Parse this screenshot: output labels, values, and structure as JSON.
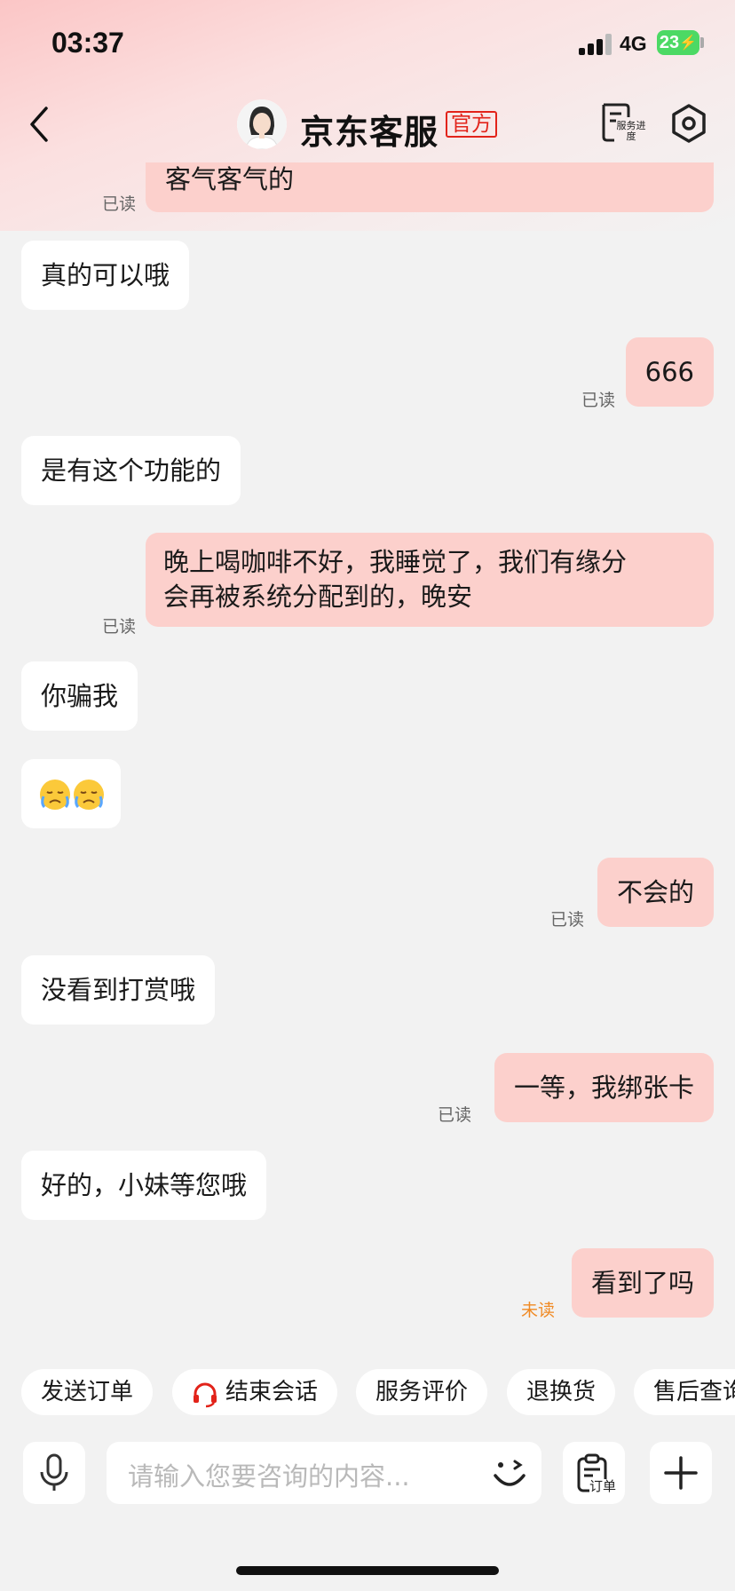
{
  "status_bar": {
    "time": "03:37",
    "network": "4G",
    "battery": "23"
  },
  "header": {
    "title": "京东客服",
    "badge": "官方",
    "service_progress_label": "服务进度"
  },
  "messages": [
    {
      "side": "out",
      "text": "客气客气的",
      "status": "已读"
    },
    {
      "side": "in",
      "text": "真的可以哦"
    },
    {
      "side": "out",
      "text": "666",
      "status": "已读"
    },
    {
      "side": "in",
      "text": "是有这个功能的"
    },
    {
      "side": "out",
      "lines": [
        "晚上喝咖啡不好，我睡觉了，我们有缘分",
        "会再被系统分配到的，晚安"
      ],
      "status": "已读"
    },
    {
      "side": "in",
      "text": "你骗我"
    },
    {
      "side": "in",
      "emoji": "😞😞"
    },
    {
      "side": "out",
      "text": "不会的",
      "status": "已读"
    },
    {
      "side": "in",
      "text": "没看到打赏哦"
    },
    {
      "side": "out",
      "text": "一等，我绑张卡",
      "status": "已读"
    },
    {
      "side": "in",
      "text": "好的，小妹等您哦"
    },
    {
      "side": "out",
      "text": "看到了吗",
      "status": "未读"
    }
  ],
  "quick_actions": [
    "发送订单",
    "结束会话",
    "服务评价",
    "退换货",
    "售后查询"
  ],
  "input": {
    "placeholder": "请输入您要咨询的内容...",
    "order_label": "订单"
  },
  "colors": {
    "accent": "#e2231a",
    "out_bubble": "#fcd0cc",
    "unread": "#f08a24",
    "battery": "#4cd964"
  }
}
